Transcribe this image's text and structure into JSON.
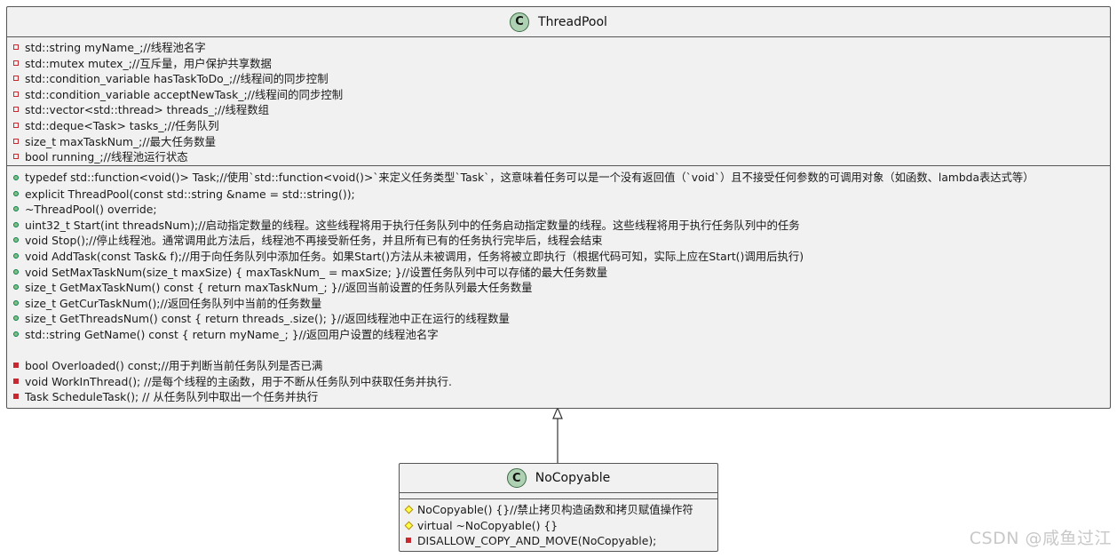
{
  "threadpool": {
    "name": "ThreadPool",
    "badge": "C",
    "fields": [
      "std::string myName_;//线程池名字",
      "std::mutex mutex_;//互斥量，用户保护共享数据",
      "std::condition_variable hasTaskToDo_;//线程间的同步控制",
      "std::condition_variable acceptNewTask_;//线程间的同步控制",
      "std::vector<std::thread> threads_;//线程数组",
      "std::deque<Task> tasks_;//任务队列",
      "size_t maxTaskNum_;//最大任务数量",
      "bool running_;//线程池运行状态"
    ],
    "public_methods": [
      "typedef std::function<void()> Task;//使用`std::function<void()>`来定义任务类型`Task`，这意味着任务可以是一个没有返回值（`void`）且不接受任何参数的可调用对象（如函数、lambda表达式等）",
      "explicit ThreadPool(const std::string &name = std::string());",
      "~ThreadPool() override;",
      "uint32_t Start(int threadsNum);//启动指定数量的线程。这些线程将用于执行任务队列中的任务启动指定数量的线程。这些线程将用于执行任务队列中的任务",
      "void Stop();//停止线程池。通常调用此方法后，线程池不再接受新任务，并且所有已有的任务执行完毕后，线程会结束",
      "void AddTask(const Task& f);//用于向任务队列中添加任务。如果Start()方法从未被调用，任务将被立即执行（根据代码可知，实际上应在Start()调用后执行)",
      "void SetMaxTaskNum(size_t maxSize) { maxTaskNum_ = maxSize; }//设置任务队列中可以存储的最大任务数量",
      "size_t GetMaxTaskNum() const { return maxTaskNum_; }//返回当前设置的任务队列最大任务数量",
      "size_t GetCurTaskNum();//返回任务队列中当前的任务数量",
      "size_t GetThreadsNum() const { return threads_.size(); }//返回线程池中正在运行的线程数量",
      "std::string GetName() const { return myName_; }//返回用户设置的线程池名字"
    ],
    "private_methods": [
      "bool Overloaded() const;//用于判断当前任务队列是否已满",
      "void WorkInThread(); //是每个线程的主函数，用于不断从任务队列中获取任务并执行.",
      "Task ScheduleTask(); // 从任务队列中取出一个任务并执行"
    ]
  },
  "nocopyable": {
    "name": "NoCopyable",
    "badge": "C",
    "protected_methods": [
      "NoCopyable() {}//禁止拷贝构造函数和拷贝赋值操作符",
      "virtual ~NoCopyable() {}"
    ],
    "private_methods": [
      "DISALLOW_COPY_AND_MOVE(NoCopyable);"
    ]
  },
  "relation": {
    "type": "inheritance",
    "from": "NoCopyable",
    "to": "ThreadPool"
  },
  "watermark": "CSDN @咸鱼过江",
  "colors": {
    "class_fill": "#f1f1f1",
    "border": "#555555",
    "badge_fill": "#add1b2",
    "private_marker": "#c82930",
    "public_marker": "#84be84",
    "protected_marker": "#ffff44"
  }
}
